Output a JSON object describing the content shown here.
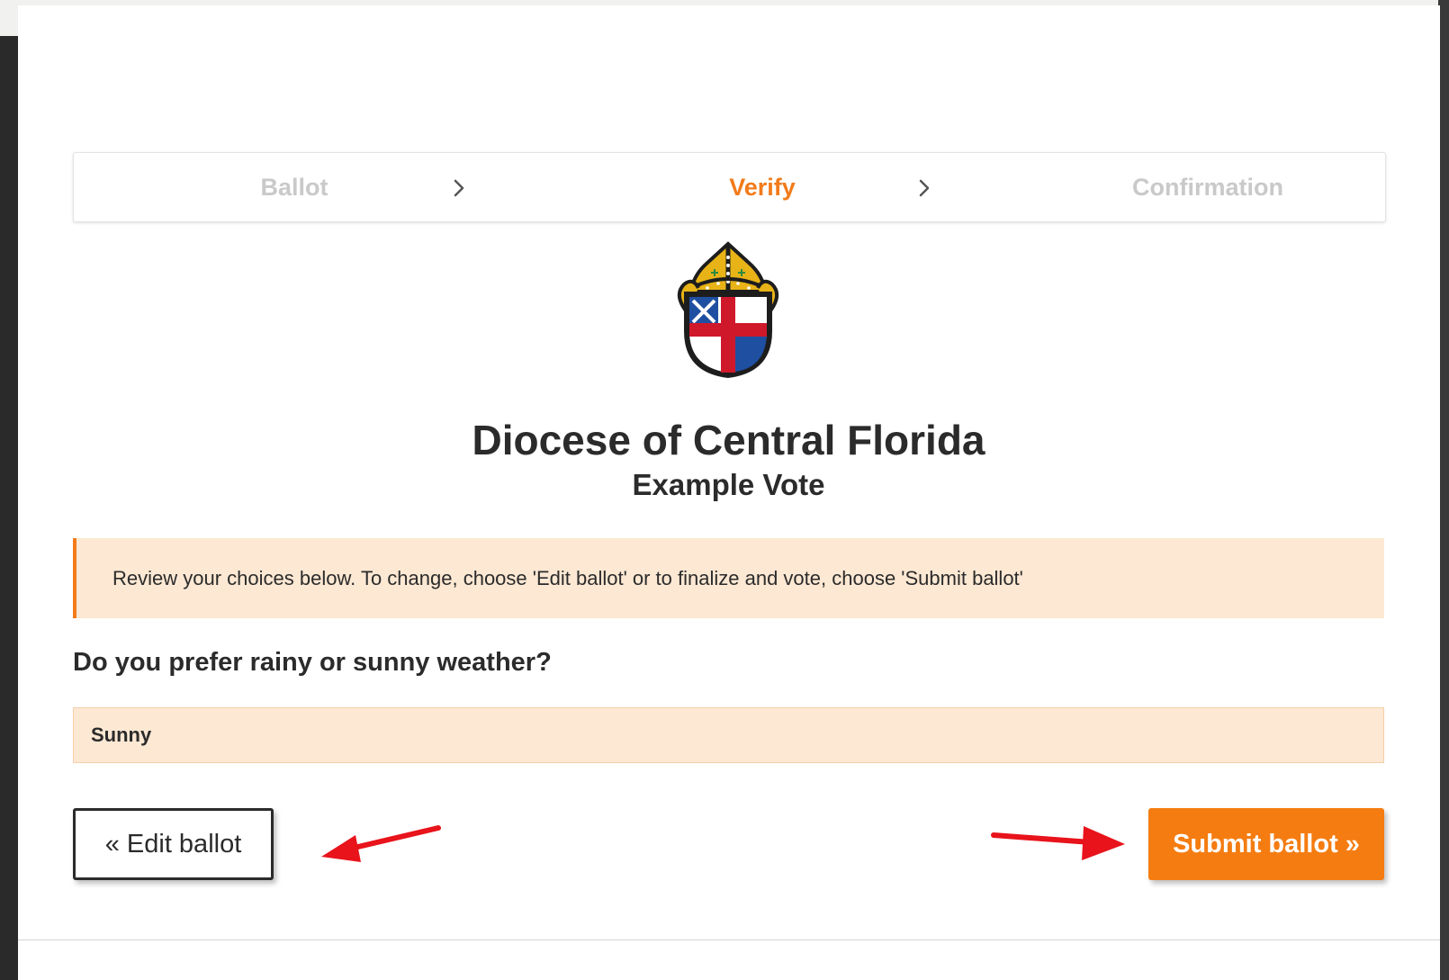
{
  "steps": {
    "ballot": "Ballot",
    "verify": "Verify",
    "confirmation": "Confirmation",
    "active": "verify"
  },
  "header": {
    "organization": "Diocese of Central Florida",
    "vote_title": "Example Vote"
  },
  "notice": {
    "text": "Review your choices below. To change, choose 'Edit ballot' or to finalize and vote, choose 'Submit ballot'"
  },
  "ballot": {
    "question": "Do you prefer rainy or sunny weather?",
    "selected_answer": "Sunny"
  },
  "actions": {
    "edit_label": "« Edit ballot",
    "submit_label": "Submit ballot »"
  },
  "colors": {
    "accent": "#f27b1a",
    "notice_bg": "#fde8d3",
    "annotation_arrow": "#e8131b"
  },
  "icons": {
    "step_separator": "chevron-right-icon",
    "logo": "diocese-shield-mitre-logo",
    "annotation": "red-arrow-icon"
  }
}
